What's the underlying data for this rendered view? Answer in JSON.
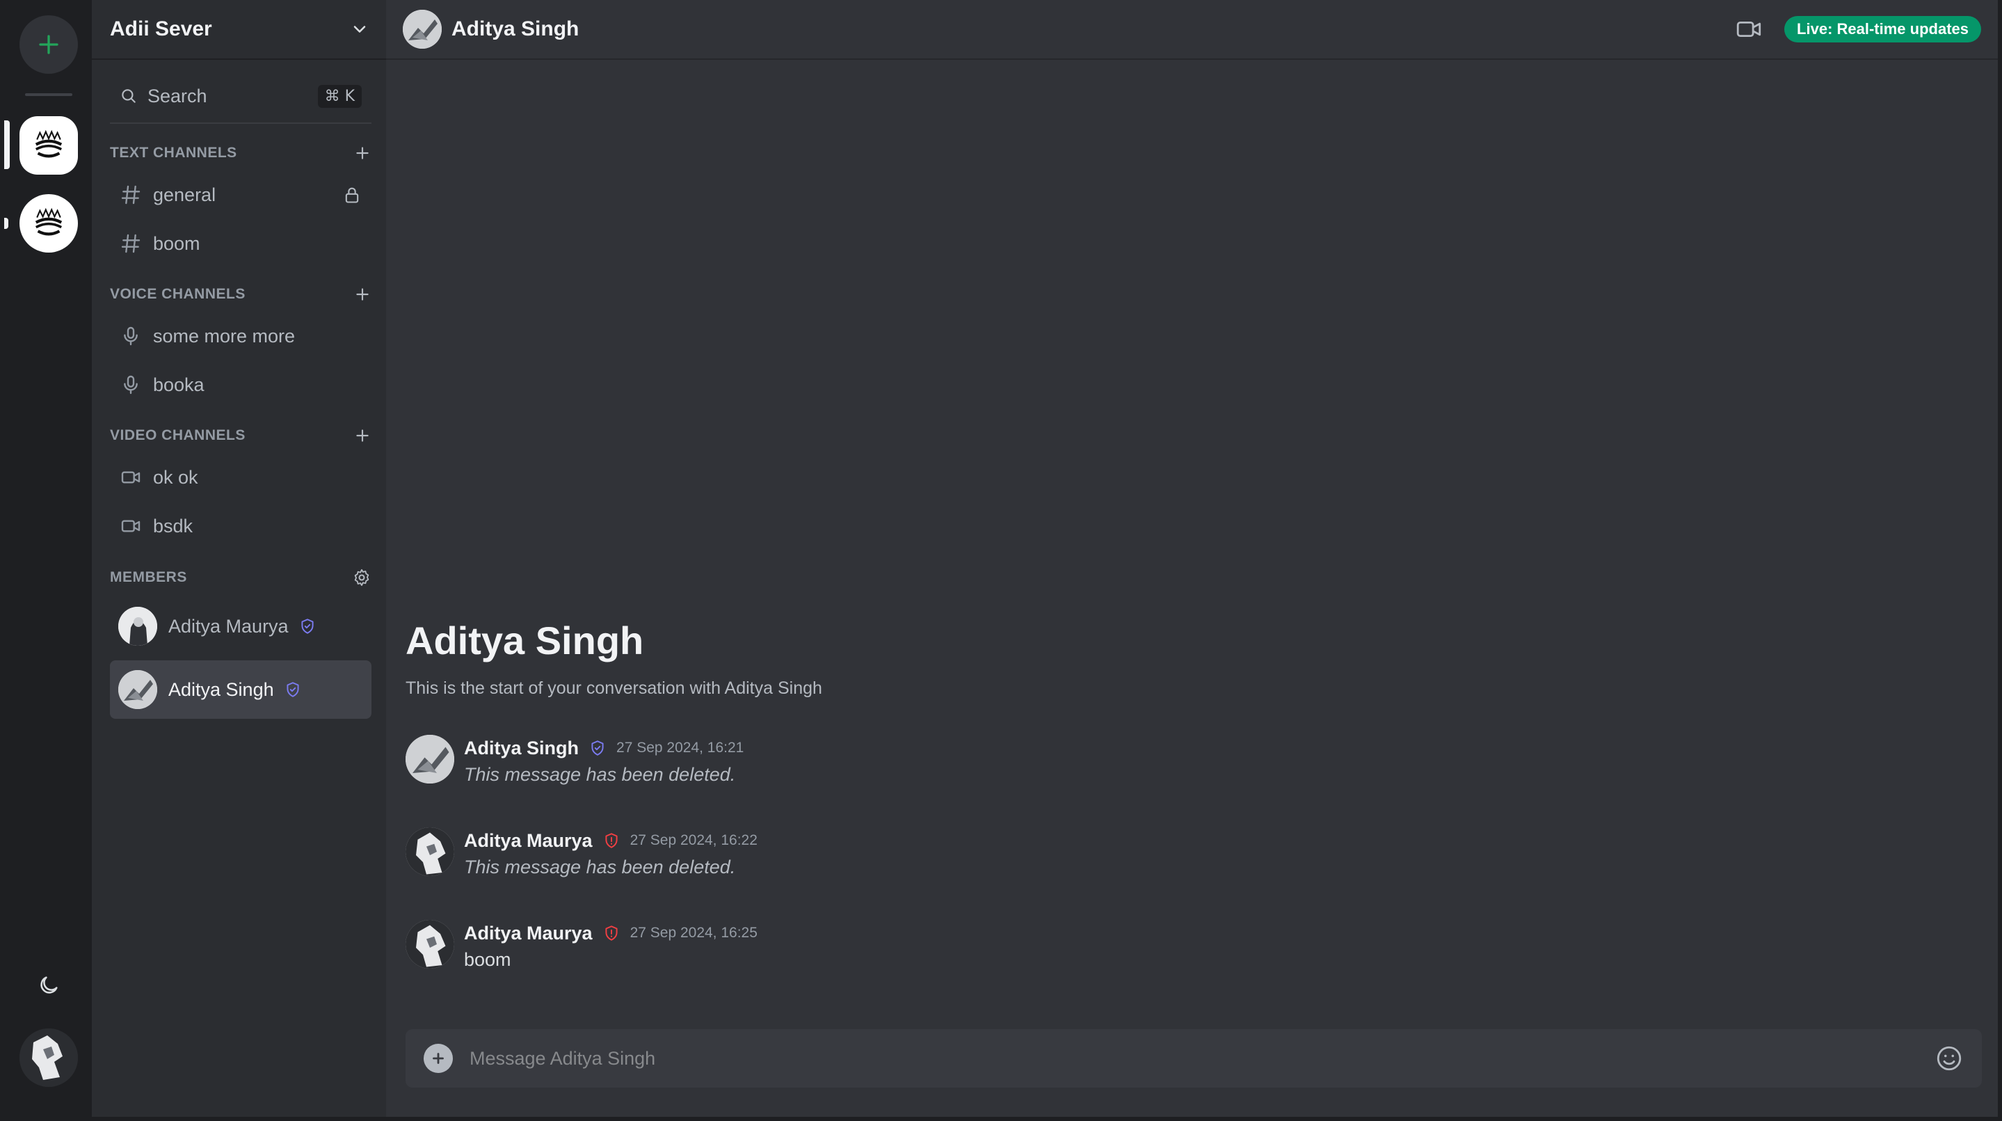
{
  "server": {
    "name": "Adii Sever",
    "search_label": "Search",
    "search_shortcut": "⌘ K"
  },
  "sections": {
    "text": "TEXT CHANNELS",
    "voice": "VOICE CHANNELS",
    "video": "VIDEO CHANNELS",
    "members": "MEMBERS"
  },
  "text_channels": [
    {
      "label": "general",
      "locked": true
    },
    {
      "label": "boom"
    }
  ],
  "voice_channels": [
    {
      "label": "some more more"
    },
    {
      "label": "booka"
    }
  ],
  "video_channels": [
    {
      "label": "ok ok"
    },
    {
      "label": "bsdk"
    }
  ],
  "members": [
    {
      "name": "Aditya Maurya",
      "role_icon": "shield-check-icon",
      "role_color": "#7b7bf0"
    },
    {
      "name": "Aditya Singh",
      "role_icon": "shield-check-icon",
      "role_color": "#7b7bf0",
      "active": true
    }
  ],
  "conversation": {
    "header_title": "Aditya Singh",
    "live_badge": "Live: Real-time updates",
    "live_color": "#059669",
    "welcome_title": "Aditya Singh",
    "welcome_subtitle": "This is the start of your conversation with Aditya Singh",
    "composer_placeholder": "Message Aditya Singh"
  },
  "messages": [
    {
      "author": "Aditya Singh",
      "role_icon": "shield-check-icon",
      "role_color": "#7b7bf0",
      "time": "27 Sep 2024, 16:21",
      "text": "This message has been deleted.",
      "deleted": true
    },
    {
      "author": "Aditya Maurya",
      "role_icon": "shield-alert-icon",
      "role_color": "#f23f43",
      "time": "27 Sep 2024, 16:22",
      "text": "This message has been deleted.",
      "deleted": true
    },
    {
      "author": "Aditya Maurya",
      "role_icon": "shield-alert-icon",
      "role_color": "#f23f43",
      "time": "27 Sep 2024, 16:25",
      "text": "boom",
      "deleted": false
    }
  ]
}
